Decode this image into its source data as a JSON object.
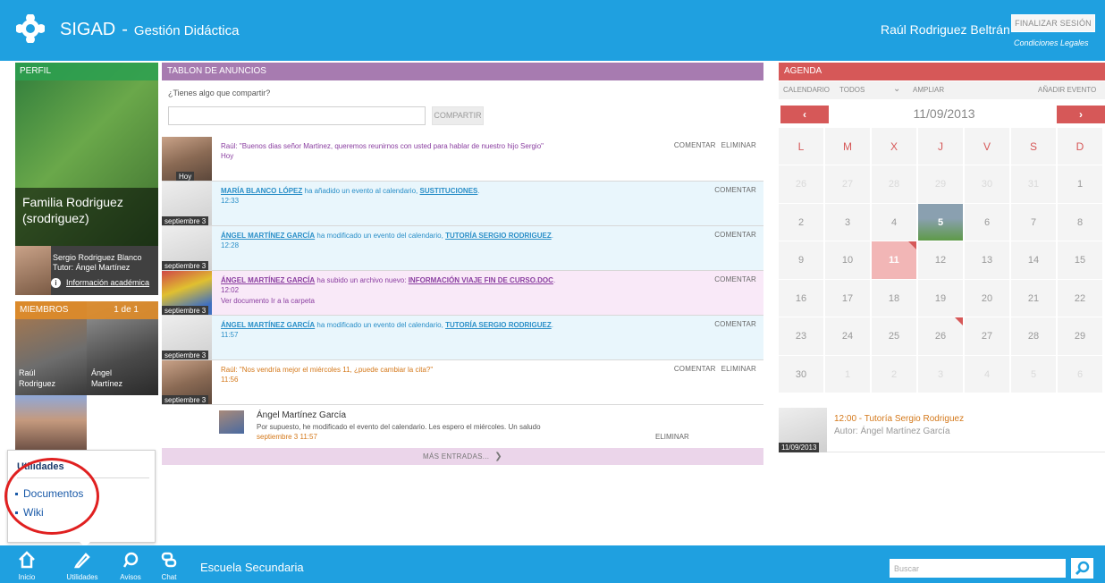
{
  "header": {
    "app_name": "SIGAD",
    "dash": "-",
    "app_subtitle": "Gestión Didáctica",
    "user_name": "Raúl Rodriguez Beltrán",
    "logout_label": "FINALIZAR SESIÓN",
    "legal_label": "Condiciones Legales",
    "brand_color": "#1fa0e0"
  },
  "profile": {
    "header": "PERFIL",
    "family_line1": "Familia Rodriguez",
    "family_line2": "(srodriguez)",
    "student_name": "Sergio Rodriguez Blanco",
    "tutor": "Tutor: Ángel Martínez",
    "academic_info": "Información académica"
  },
  "members": {
    "header": "MIEMBROS",
    "count": "1 de 1",
    "m1_first": "Raúl",
    "m1_last": "Rodriguez",
    "m2_first": "Ángel",
    "m2_last": "Martínez"
  },
  "utilities_popover": {
    "title": "Utilidades",
    "items": [
      "Documentos",
      "Wiki"
    ]
  },
  "board": {
    "header": "TABLON DE ANUNCIOS",
    "share_question": "¿Tienes algo que compartir?",
    "share_button": "COMPARTIR",
    "posts": [
      {
        "tag": "Hoy",
        "text": "Raúl: \"Buenos dias señor Martinez, queremos reunirnos con usted para hablar de nuestro hijo Sergio\"",
        "time": "Hoy",
        "comment": "COMENTAR",
        "delete": "ELIMINAR"
      },
      {
        "tag": "septiembre 3",
        "actor": "MARÍA BLANCO LÓPEZ",
        "action": " ha añadido un evento al calendario, ",
        "object": "SUSTITUCIONES",
        "end": ".",
        "time": "12:33",
        "comment": "COMENTAR"
      },
      {
        "tag": "septiembre 3",
        "actor": "ÁNGEL MARTÍNEZ GARCÍA",
        "action": " ha modificado un evento del calendario, ",
        "object": "TUTORÍA SERGIO RODRIGUEZ",
        "end": ".",
        "time": "12:28",
        "comment": "COMENTAR"
      },
      {
        "tag": "septiembre 3",
        "actor": "ÁNGEL MARTÍNEZ GARCÍA",
        "action": " ha subido un archivo nuevo: ",
        "object": "INFORMACIÓN VIAJE FIN DE CURSO.DOC",
        "end": ".",
        "time": "12:02",
        "link1": "Ver documento",
        "link2": "Ir a la carpeta",
        "comment": "COMENTAR"
      },
      {
        "tag": "septiembre 3",
        "actor": "ÁNGEL MARTÍNEZ GARCÍA",
        "action": " ha modificado un evento del calendario, ",
        "object": "TUTORÍA SERGIO RODRIGUEZ",
        "end": ".",
        "time": "11:57",
        "comment": "COMENTAR"
      },
      {
        "tag": "septiembre 3",
        "text": "Raúl: \"Nos vendría mejor el miércoles 11, ¿puede cambiar la cita?\"",
        "time": "11:56",
        "comment": "COMENTAR",
        "delete": "ELIMINAR"
      }
    ],
    "reply": {
      "name": "Ángel Martínez García",
      "text": "Por supuesto, he modificado el evento del calendario. Les espero el miércoles. Un saludo",
      "date": "septiembre 3 11:57",
      "delete": "ELIMINAR"
    },
    "more_label": "MÁS ENTRADAS..."
  },
  "agenda": {
    "header": "AGENDA",
    "toolbar": {
      "calendar": "CALENDARIO",
      "filter": "TODOS",
      "expand": "AMPLIAR",
      "add_event": "AÑADIR EVENTO"
    },
    "current_date": "11/09/2013",
    "weekdays": [
      "L",
      "M",
      "X",
      "J",
      "V",
      "S",
      "D"
    ],
    "weeks": [
      [
        "26",
        "27",
        "28",
        "29",
        "30",
        "31",
        "1"
      ],
      [
        "2",
        "3",
        "4",
        "5",
        "6",
        "7",
        "8"
      ],
      [
        "9",
        "10",
        "11",
        "12",
        "13",
        "14",
        "15"
      ],
      [
        "16",
        "17",
        "18",
        "19",
        "20",
        "21",
        "22"
      ],
      [
        "23",
        "24",
        "25",
        "26",
        "27",
        "28",
        "29"
      ],
      [
        "30",
        "1",
        "2",
        "3",
        "4",
        "5",
        "6"
      ]
    ],
    "event": {
      "date_tag": "11/09/2013",
      "title": "12:00  - Tutoría Sergio Rodriguez",
      "author": "Autor: Ángel Martínez García"
    },
    "accent_color": "#d65858"
  },
  "footer": {
    "nav": [
      "Inicio",
      "Utilidades",
      "Avisos",
      "Chat"
    ],
    "school": "Escuela Secundaria",
    "search_placeholder": "Buscar"
  }
}
